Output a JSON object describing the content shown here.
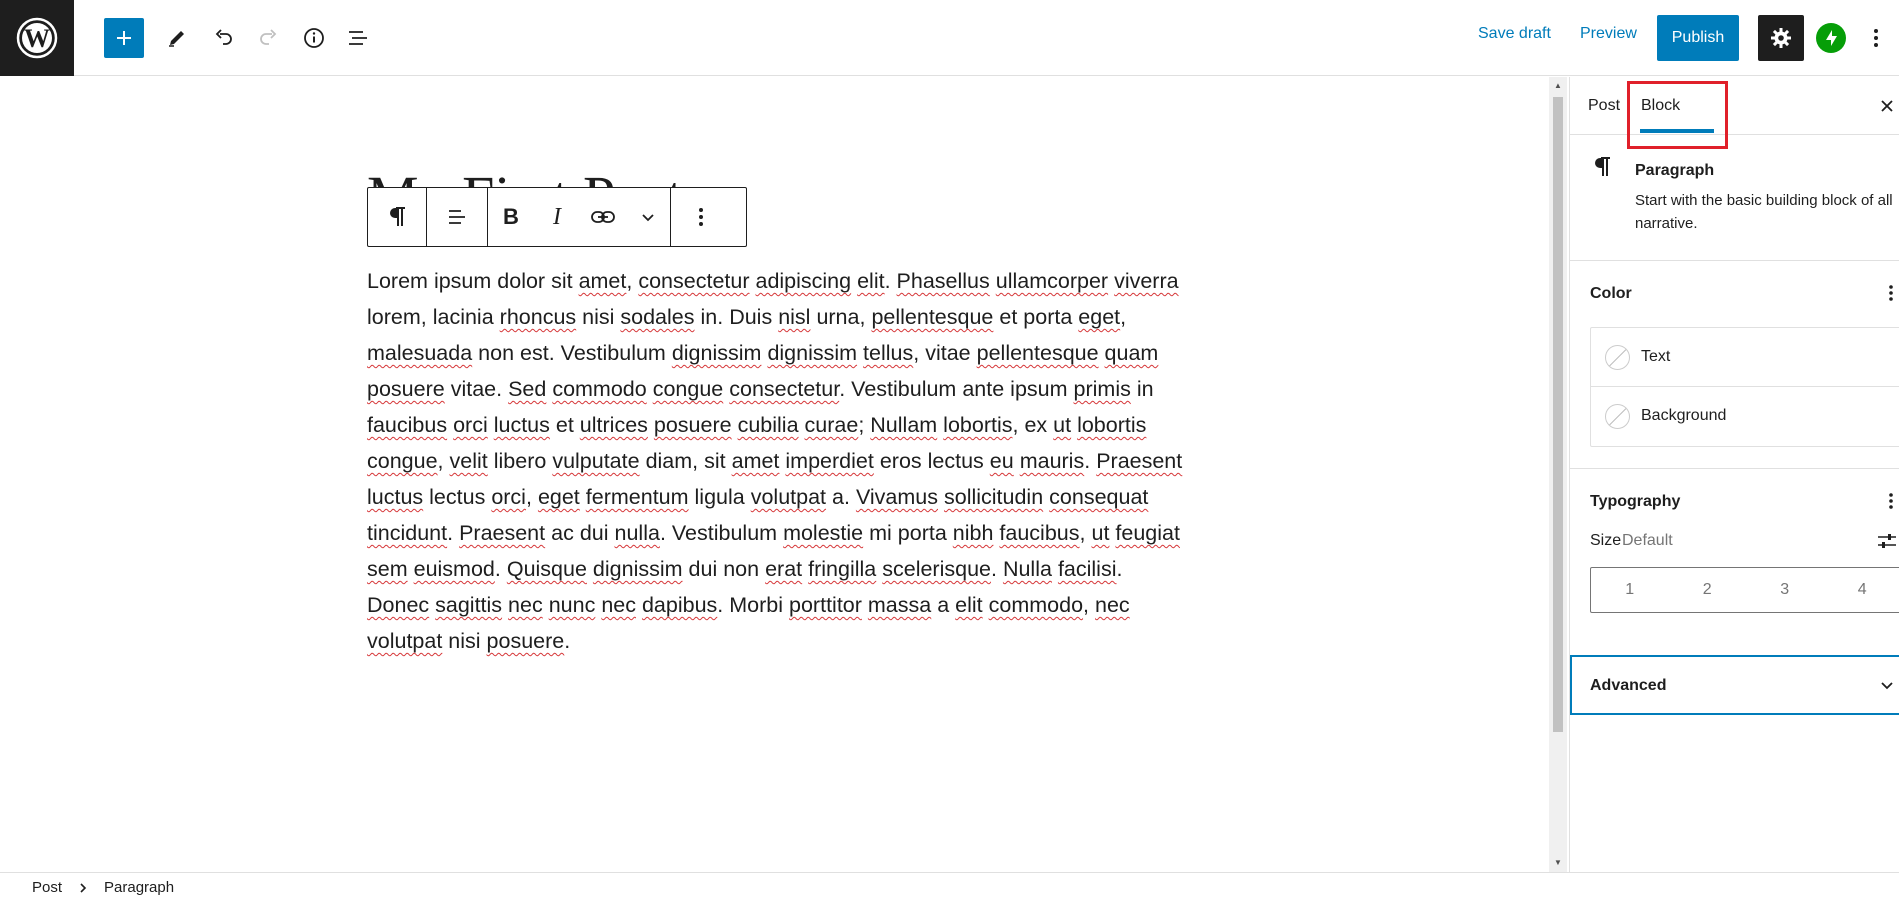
{
  "topbar": {
    "save_draft": "Save draft",
    "preview": "Preview",
    "publish": "Publish",
    "icons": [
      "wordpress-logo",
      "plus",
      "pencil",
      "undo",
      "redo",
      "info",
      "list-view",
      "gear",
      "jetpack",
      "more-vertical"
    ],
    "accent_color": "#007cba"
  },
  "editor": {
    "post_title": "My First Post",
    "paragraph_html_words": "Lorem ipsum dolor sit amet, consectetur adipiscing elit. Phasellus ullamcorper viverra lorem, lacinia rhoncus nisi sodales in. Duis nisl urna, pellentesque et porta eget, malesuada non est. Vestibulum dignissim dignissim tellus, vitae pellentesque quam posuere vitae. Sed commodo congue consectetur. Vestibulum ante ipsum primis in faucibus orci luctus et ultrices posuere cubilia curae; Nullam lobortis, ex ut lobortis congue, velit libero vulputate diam, sit amet imperdiet eros lectus eu mauris. Praesent luctus lectus orci, eget fermentum ligula volutpat a. Vivamus sollicitudin consequat tincidunt. Praesent ac dui nulla. Vestibulum molestie mi porta nibh faucibus, ut feugiat sem euismod. Quisque dignissim dui non erat fringilla scelerisque. Nulla facilisi. Donec sagittis nec nunc nec dapibus. Morbi porttitor massa a elit commodo, nec volutpat nisi posuere.",
    "toolbar_icons": [
      "paragraph",
      "align-left",
      "bold",
      "italic",
      "link",
      "chevron-down",
      "more-vertical"
    ]
  },
  "sidebar": {
    "tabs": [
      {
        "label": "Post"
      },
      {
        "label": "Block"
      }
    ],
    "block": {
      "title": "Paragraph",
      "description": "Start with the basic building block of all narrative."
    },
    "color": {
      "title": "Color",
      "items": [
        {
          "label": "Text"
        },
        {
          "label": "Background"
        }
      ]
    },
    "typography": {
      "title": "Typography",
      "size_label": "Size",
      "size_value": "Default",
      "sizes": [
        "1",
        "2",
        "3",
        "4"
      ]
    },
    "advanced": {
      "title": "Advanced"
    },
    "highlight_color": "#e0202a"
  },
  "footer": {
    "breadcrumb": [
      {
        "label": "Post"
      },
      {
        "label": "Paragraph"
      }
    ]
  }
}
